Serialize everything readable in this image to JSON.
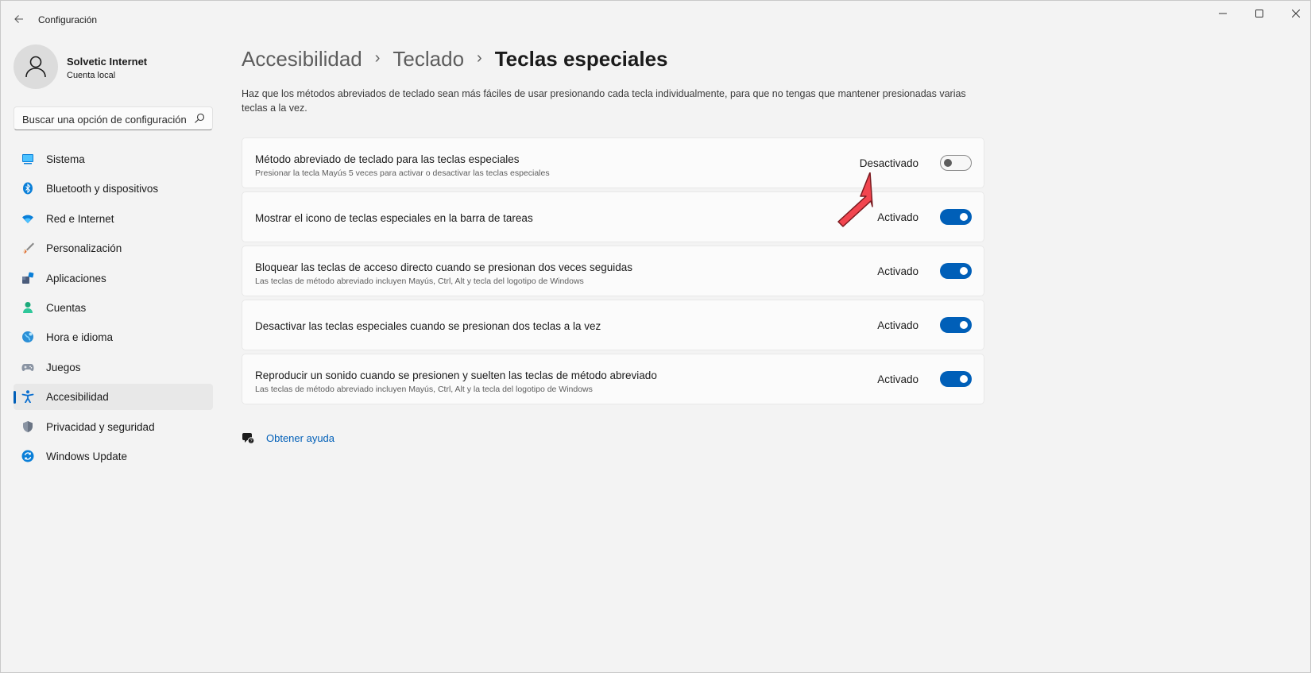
{
  "window": {
    "title": "Configuración"
  },
  "profile": {
    "name": "Solvetic Internet",
    "account_type": "Cuenta local"
  },
  "search": {
    "placeholder": "Buscar una opción de configuración"
  },
  "sidebar": {
    "items": [
      {
        "label": "Sistema",
        "icon": "system-icon",
        "selected": false
      },
      {
        "label": "Bluetooth y dispositivos",
        "icon": "bluetooth-icon",
        "selected": false
      },
      {
        "label": "Red e Internet",
        "icon": "wifi-icon",
        "selected": false
      },
      {
        "label": "Personalización",
        "icon": "brush-icon",
        "selected": false
      },
      {
        "label": "Aplicaciones",
        "icon": "apps-icon",
        "selected": false
      },
      {
        "label": "Cuentas",
        "icon": "accounts-icon",
        "selected": false
      },
      {
        "label": "Hora e idioma",
        "icon": "time-language-icon",
        "selected": false
      },
      {
        "label": "Juegos",
        "icon": "gamepad-icon",
        "selected": false
      },
      {
        "label": "Accesibilidad",
        "icon": "accessibility-icon",
        "selected": true
      },
      {
        "label": "Privacidad y seguridad",
        "icon": "shield-icon",
        "selected": false
      },
      {
        "label": "Windows Update",
        "icon": "update-icon",
        "selected": false
      }
    ]
  },
  "breadcrumb": {
    "level1": "Accesibilidad",
    "level2": "Teclado",
    "current": "Teclas especiales"
  },
  "description": "Haz que los métodos abreviados de teclado sean más fáciles de usar presionando cada tecla individualmente, para que no tengas que mantener presionadas varias teclas a la vez.",
  "settings": [
    {
      "title": "Método abreviado de teclado para las teclas especiales",
      "subtitle": "Presionar la tecla Mayús 5 veces para activar o desactivar las teclas especiales",
      "state": "Desactivado",
      "on": false
    },
    {
      "title": "Mostrar el icono de teclas especiales en la barra de tareas",
      "subtitle": "",
      "state": "Activado",
      "on": true
    },
    {
      "title": "Bloquear las teclas de acceso directo cuando se presionan dos veces seguidas",
      "subtitle": "Las teclas de método abreviado incluyen Mayús, Ctrl, Alt y tecla del logotipo de Windows",
      "state": "Activado",
      "on": true
    },
    {
      "title": "Desactivar las teclas especiales cuando se presionan dos teclas a la vez",
      "subtitle": "",
      "state": "Activado",
      "on": true
    },
    {
      "title": "Reproducir un sonido cuando se presionen y suelten las teclas de método abreviado",
      "subtitle": "Las teclas de método abreviado incluyen Mayús, Ctrl, Alt y la tecla del logotipo de Windows",
      "state": "Activado",
      "on": true
    }
  ],
  "help": {
    "label": "Obtener ayuda"
  },
  "colors": {
    "accent": "#005fb8",
    "annotation_arrow": "#f2454f"
  }
}
